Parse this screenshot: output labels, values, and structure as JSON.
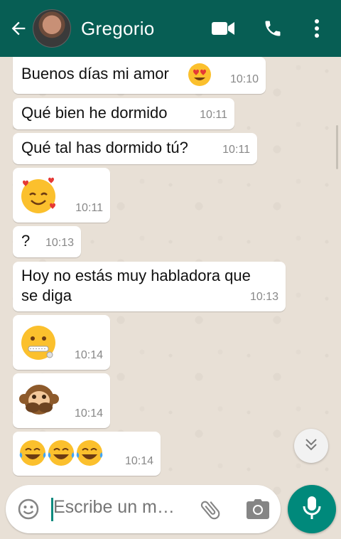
{
  "header": {
    "contact_name": "Gregorio",
    "back_icon": "arrow-left-icon",
    "actions": [
      "video-call-icon",
      "phone-icon",
      "more-vert-icon"
    ],
    "bg_color": "#075e54"
  },
  "messages": [
    {
      "text": "Buenos días mi amor",
      "emoji": "heart-eyes-emoji",
      "time": "10:10"
    },
    {
      "text": "Qué bien he dormido",
      "time": "10:11"
    },
    {
      "text": "Qué tal has dormido tú?",
      "time": "10:11"
    },
    {
      "text": "",
      "emoji": "smiling-face-with-hearts-emoji",
      "time": "10:11"
    },
    {
      "text": "?",
      "time": "10:13"
    },
    {
      "text_line1": "Hoy no estás muy habladora que",
      "text_line2": "se diga",
      "time": "10:13"
    },
    {
      "text": "",
      "emoji": "zipper-mouth-emoji",
      "time": "10:14"
    },
    {
      "text": "",
      "emoji": "speak-no-evil-monkey-emoji",
      "time": "10:14"
    },
    {
      "text": "",
      "emoji": "tears-of-joy-emoji-x3",
      "time": "10:14"
    }
  ],
  "composer": {
    "placeholder": "Escribe un m…",
    "emoji_icon": "smiley-icon",
    "attach_icon": "paperclip-icon",
    "camera_icon": "camera-icon",
    "mic_icon": "microphone-icon",
    "accent": "#00897b"
  },
  "scroll_down_icon": "double-chevron-down-icon"
}
